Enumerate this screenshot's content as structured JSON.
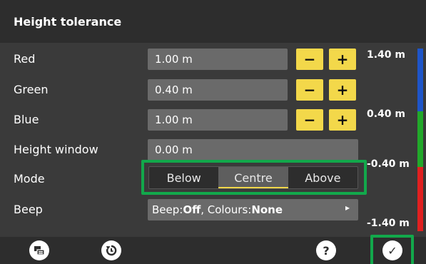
{
  "header": {
    "title": "Height tolerance"
  },
  "rows": [
    {
      "label": "Red",
      "value": "1.00 m"
    },
    {
      "label": "Green",
      "value": "0.40 m"
    },
    {
      "label": "Blue",
      "value": "1.00 m"
    },
    {
      "label": "Height window",
      "value": "0.00 m"
    }
  ],
  "buttons": {
    "minus": "−",
    "plus": "+"
  },
  "mode": {
    "label": "Mode",
    "options": [
      "Below",
      "Centre",
      "Above"
    ],
    "selected": "Centre"
  },
  "beep": {
    "label": "Beep",
    "beep_prefix": "Beep:",
    "beep_value": "Off",
    "colours_prefix": ", Colours:",
    "colours_value": "None",
    "arrow": "▸"
  },
  "scale": {
    "labels": [
      "1.40 m",
      "0.40 m",
      "-0.40 m",
      "-1.40 m"
    ],
    "colors": {
      "blue": "#1e55c8",
      "green": "#22a82a",
      "red": "#e02020"
    }
  },
  "footer": {
    "icons": [
      "screen-icon",
      "reset-icon",
      "help-icon",
      "ok-icon"
    ],
    "help_glyph": "?",
    "ok_glyph": "✓"
  }
}
